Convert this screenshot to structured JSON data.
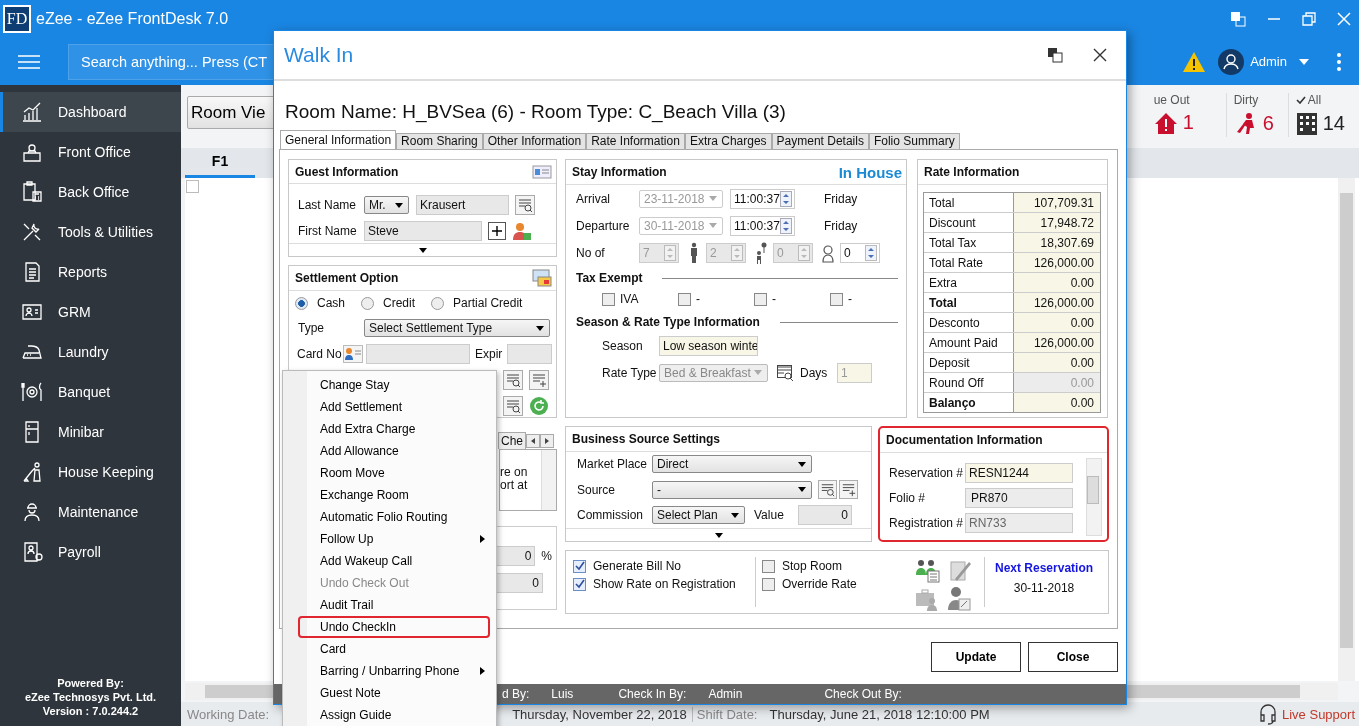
{
  "app": {
    "logo": "FD",
    "title": "eZee - eZee FrontDesk 7.0"
  },
  "header": {
    "search": {
      "placeholder": "Search anything... Press (CT"
    },
    "user": "Admin"
  },
  "sidebar": {
    "items": [
      {
        "label": "Dashboard",
        "kind": "chart",
        "selected": true
      },
      {
        "label": "Front Office",
        "kind": "desk",
        "selected": false
      },
      {
        "label": "Back Office",
        "kind": "office",
        "selected": false
      },
      {
        "label": "Tools & Utilities",
        "kind": "tools",
        "selected": false
      },
      {
        "label": "Reports",
        "kind": "reports",
        "selected": false
      },
      {
        "label": "GRM",
        "kind": "grm",
        "selected": false
      },
      {
        "label": "Laundry",
        "kind": "laundry",
        "selected": false
      },
      {
        "label": "Banquet",
        "kind": "banquet",
        "selected": false
      },
      {
        "label": "Minibar",
        "kind": "minibar",
        "selected": false
      },
      {
        "label": "House Keeping",
        "kind": "housekeeping",
        "selected": false
      },
      {
        "label": "Maintenance",
        "kind": "maintenance",
        "selected": false
      },
      {
        "label": "Payroll",
        "kind": "payroll",
        "selected": false
      }
    ],
    "footer": [
      "Powered By:",
      "eZee Technosys Pvt. Ltd.",
      "Version : 7.0.244.2"
    ]
  },
  "main": {
    "view_button": "Room Vie",
    "stats": [
      {
        "kind": "due_out",
        "label": "ue Out",
        "count": "1"
      },
      {
        "kind": "dirty",
        "label": "Dirty",
        "count": "6"
      },
      {
        "kind": "all",
        "label": "All",
        "count": "14"
      }
    ],
    "tabs": [
      {
        "label": "F1",
        "selected": true
      }
    ],
    "select_all": {
      "checked": false
    }
  },
  "status_bar": {
    "working_label": "Working Date:",
    "date_value": "Thursday, November 22, 2018",
    "shift_label": "Shift Date:",
    "shift_value": "Thursday, June 21, 2018 12:10:00 PM",
    "support": "Live Support"
  },
  "dialog": {
    "title": "Walk In",
    "heading": "Room Name: H_BVSea (6) - Room Type: C_Beach Villa (3)",
    "tabs": [
      {
        "label": "General Information",
        "selected": true
      },
      {
        "label": "Room Sharing",
        "selected": false
      },
      {
        "label": "Other Information",
        "selected": false
      },
      {
        "label": "Rate Information",
        "selected": false
      },
      {
        "label": "Extra Charges",
        "selected": false
      },
      {
        "label": "Payment Details",
        "selected": false
      },
      {
        "label": "Folio Summary",
        "selected": false
      }
    ],
    "guest": {
      "title": "Guest Information",
      "last_name_label": "Last Name",
      "salutation": "Mr.",
      "last_name": "Krausert",
      "first_name_label": "First Name",
      "first_name": "Steve"
    },
    "settlement": {
      "title": "Settlement Option",
      "options": [
        {
          "label": "Cash",
          "selected": true
        },
        {
          "label": "Credit",
          "selected": false
        },
        {
          "label": "Partial Credit",
          "selected": false
        }
      ],
      "type_label": "Type",
      "type_value": "Select Settlement Type",
      "card_label": "Card No",
      "expiry_label": "Expir"
    },
    "lower_left": {
      "tab": "Che",
      "note_lines": [
        "re on",
        "ort at"
      ],
      "percent_value": "0",
      "percent_unit": "%",
      "amount_value": "0"
    },
    "stay": {
      "title": "Stay Information",
      "status": "In House",
      "rows": [
        {
          "label": "Arrival",
          "date": "23-11-2018",
          "time": "11:00:37",
          "day": "Friday"
        },
        {
          "label": "Departure",
          "date": "30-11-2018",
          "time": "11:00:37",
          "day": "Friday"
        }
      ],
      "count_label": "No of",
      "counts": [
        {
          "kind": "rooms",
          "value": "7",
          "disabled": true
        },
        {
          "kind": "adult",
          "value": "2",
          "disabled": true
        },
        {
          "kind": "child",
          "value": "0",
          "disabled": true
        },
        {
          "kind": "infant",
          "value": "0",
          "disabled": false
        }
      ],
      "tax_title": "Tax Exempt",
      "taxes": [
        {
          "label": "IVA",
          "checked": false
        },
        {
          "label": "-",
          "checked": false
        },
        {
          "label": "-",
          "checked": false
        },
        {
          "label": "-",
          "checked": false
        }
      ],
      "season_title": "Season & Rate Type Information",
      "season_label": "Season",
      "season": "Low season winte",
      "rate_type_label": "Rate Type",
      "rate_type": "Bed & Breakfast",
      "days_label": "Days",
      "days": "1"
    },
    "rates": {
      "title": "Rate Information",
      "rows": [
        {
          "label": "Total",
          "value": "107,709.31",
          "bold": false,
          "disabled": false
        },
        {
          "label": "Discount",
          "value": "17,948.72",
          "bold": false,
          "disabled": false
        },
        {
          "label": "Total Tax",
          "value": "18,307.69",
          "bold": false,
          "disabled": false
        },
        {
          "label": "Total Rate",
          "value": "126,000.00",
          "bold": false,
          "disabled": false
        },
        {
          "label": "Extra",
          "value": "0.00",
          "bold": false,
          "disabled": false
        },
        {
          "label": "Total",
          "value": "126,000.00",
          "bold": true,
          "disabled": false
        },
        {
          "label": "Desconto",
          "value": "0.00",
          "bold": false,
          "disabled": false
        },
        {
          "label": "Amount Paid",
          "value": "126,000.00",
          "bold": false,
          "disabled": false
        },
        {
          "label": "Deposit",
          "value": "0.00",
          "bold": false,
          "disabled": false
        },
        {
          "label": "Round Off",
          "value": "0.00",
          "bold": false,
          "disabled": true
        },
        {
          "label": "Balanço",
          "value": "0.00",
          "bold": true,
          "disabled": false
        }
      ]
    },
    "business": {
      "title": "Business Source Settings",
      "market_label": "Market Place",
      "market": "Direct",
      "source_label": "Source",
      "source": "-",
      "commission_label": "Commission",
      "commission": "Select Plan",
      "value_label": "Value",
      "value": "0"
    },
    "documentation": {
      "title": "Documentation Information",
      "highlighted": true,
      "rows": [
        {
          "label": "Reservation #",
          "value": "RESN1244",
          "kind": "highlight"
        },
        {
          "label": "Folio #",
          "value": "PR870",
          "kind": "readonly"
        },
        {
          "label": "Registration #",
          "value": "RN733",
          "kind": "disabled"
        }
      ]
    },
    "options": {
      "checks_left": [
        {
          "label": "Generate Bill No",
          "checked": true
        },
        {
          "label": "Show Rate on Registration",
          "checked": true
        }
      ],
      "checks_right": [
        {
          "label": "Stop Room",
          "checked": false
        },
        {
          "label": "Override Rate",
          "checked": false
        }
      ],
      "next_label": "Next Reservation",
      "next_date": "30-11-2018"
    },
    "buttons": [
      "Update",
      "Close"
    ],
    "footer": [
      {
        "label": "d By:",
        "value": "Luis"
      },
      {
        "label": "Check In By:",
        "value": "Admin"
      },
      {
        "label": "Check Out By:"
      }
    ]
  },
  "context_menu": {
    "items": [
      {
        "label": "Change Stay",
        "disabled": false,
        "submenu": false,
        "highlighted": false
      },
      {
        "label": "Add Settlement",
        "disabled": false,
        "submenu": false,
        "highlighted": false
      },
      {
        "label": "Add Extra Charge",
        "disabled": false,
        "submenu": false,
        "highlighted": false
      },
      {
        "label": "Add Allowance",
        "disabled": false,
        "submenu": false,
        "highlighted": false
      },
      {
        "label": "Room Move",
        "disabled": false,
        "submenu": false,
        "highlighted": false
      },
      {
        "label": "Exchange Room",
        "disabled": false,
        "submenu": false,
        "highlighted": false
      },
      {
        "label": "Automatic Folio Routing",
        "disabled": false,
        "submenu": false,
        "highlighted": false
      },
      {
        "label": "Follow Up",
        "disabled": false,
        "submenu": true,
        "highlighted": false
      },
      {
        "label": "Add Wakeup Call",
        "disabled": false,
        "submenu": false,
        "highlighted": false
      },
      {
        "label": "Undo Check Out",
        "disabled": true,
        "submenu": false,
        "highlighted": false
      },
      {
        "label": "Audit Trail",
        "disabled": false,
        "submenu": false,
        "highlighted": false
      },
      {
        "label": "Undo CheckIn",
        "disabled": false,
        "submenu": false,
        "highlighted": true
      },
      {
        "label": "Card",
        "disabled": false,
        "submenu": false,
        "highlighted": false
      },
      {
        "label": "Barring / Unbarring Phone",
        "disabled": false,
        "submenu": true,
        "highlighted": false
      },
      {
        "label": "Guest Note",
        "disabled": false,
        "submenu": false,
        "highlighted": false
      },
      {
        "label": "Assign Guide",
        "disabled": false,
        "submenu": false,
        "highlighted": false
      }
    ]
  }
}
